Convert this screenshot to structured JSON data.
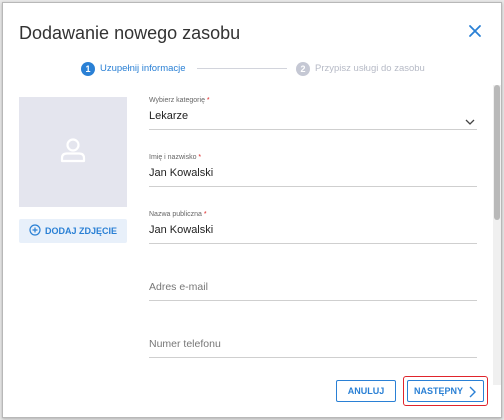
{
  "dialog": {
    "title": "Dodawanie nowego zasobu"
  },
  "stepper": {
    "steps": [
      {
        "number": "1",
        "label": "Uzupełnij informacje",
        "active": true
      },
      {
        "number": "2",
        "label": "Przypisz usługi do zasobu",
        "active": false
      }
    ]
  },
  "photo": {
    "icon": "user-avatar-icon",
    "add_label": "DODAJ ZDJĘCIE"
  },
  "form": {
    "category": {
      "label": "Wybierz kategorię",
      "required_mark": "*",
      "value": "Lekarze"
    },
    "full_name": {
      "label": "Imię i nazwisko",
      "required_mark": "*",
      "value": "Jan Kowalski"
    },
    "public_name": {
      "label": "Nazwa publiczna",
      "required_mark": "*",
      "value": "Jan Kowalski"
    },
    "email": {
      "placeholder": "Adres e-mail"
    },
    "phone": {
      "placeholder": "Numer telefonu"
    }
  },
  "footer": {
    "cancel_label": "ANULUJ",
    "next_label": "NASTĘPNY"
  },
  "colors": {
    "accent": "#2a80d5",
    "highlight": "#e0242c",
    "inactive": "#c5c8d4"
  }
}
